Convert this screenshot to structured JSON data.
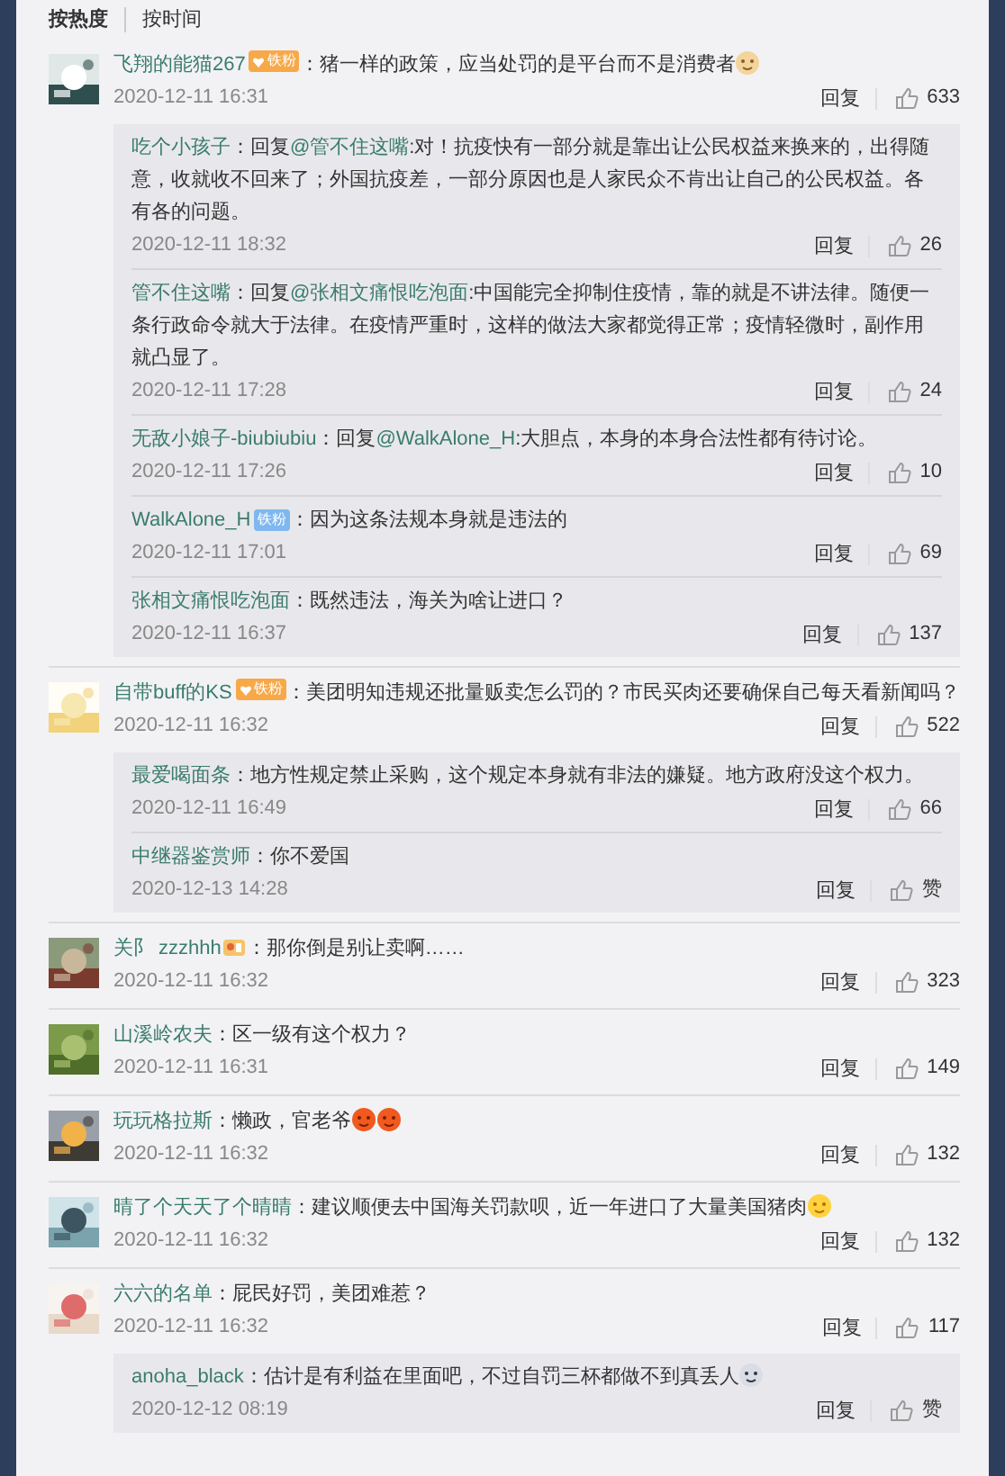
{
  "tabs": [
    {
      "label": "按热度",
      "selected": true
    },
    {
      "label": "按时间",
      "selected": false
    }
  ],
  "comments": [
    {
      "avatar": {
        "kind": "picture"
      },
      "user": "飞翔的能猫267",
      "badge": {
        "kind": "orange",
        "label": "铁粉"
      },
      "text": "：猪一样的政策，应当处罚的是平台而不是消费者",
      "emojis": [
        {
          "kind": "doge"
        }
      ],
      "date": "2020-12-11 16:31",
      "reply_label": "回复",
      "likes": "633",
      "replies": [
        {
          "user": "吃个小孩子",
          "prefix": "：回复",
          "mention": "@管不住这嘴",
          "text": ":对！抗疫快有一部分就是靠出让公民权益来换来的，出得随意，收就收不回来了；外国抗疫差，一部分原因也是人家民众不肯出让自己的公民权益。各有各的问题。",
          "date": "2020-12-11 18:32",
          "reply_label": "回复",
          "likes": "26"
        },
        {
          "user": "管不住这嘴",
          "prefix": "：回复",
          "mention": "@张相文痛恨吃泡面",
          "text": ":中国能完全抑制住疫情，靠的就是不讲法律。随便一条行政命令就大于法律。在疫情严重时，这样的做法大家都觉得正常；疫情轻微时，副作用就凸显了。",
          "date": "2020-12-11 17:28",
          "reply_label": "回复",
          "likes": "24"
        },
        {
          "user": "无敌小娘子-biubiubiu",
          "prefix": "：回复",
          "mention": "@WalkAlone_H",
          "text": ":大胆点，本身的本身合法性都有待讨论。",
          "date": "2020-12-11 17:26",
          "reply_label": "回复",
          "likes": "10"
        },
        {
          "user": "WalkAlone_H",
          "badge": {
            "kind": "blue",
            "label": "铁粉"
          },
          "text": "：因为这条法规本身就是违法的",
          "date": "2020-12-11 17:01",
          "reply_label": "回复",
          "likes": "69"
        },
        {
          "user": "张相文痛恨吃泡面",
          "text": "：既然违法，海关为啥让进口？",
          "date": "2020-12-11 16:37",
          "reply_label": "回复",
          "likes": "137"
        }
      ]
    },
    {
      "avatar": {
        "kind": "picture"
      },
      "user": "自带buff的KS",
      "badge": {
        "kind": "orange",
        "label": "铁粉"
      },
      "text": "：美团明知违规还批量贩卖怎么罚的？市民买肉还要确保自己每天看新闻吗？",
      "date": "2020-12-11 16:32",
      "reply_label": "回复",
      "likes": "522",
      "replies": [
        {
          "user": "最爱喝面条",
          "text": "：地方性规定禁止采购，这个规定本身就有非法的嫌疑。地方政府没这个权力。",
          "date": "2020-12-11 16:49",
          "reply_label": "回复",
          "likes": "66"
        },
        {
          "user": "中继器鉴赏师",
          "text": "：你不爱国",
          "date": "2020-12-13 14:28",
          "reply_label": "回复",
          "likes": "赞"
        }
      ]
    },
    {
      "avatar": {
        "kind": "picture"
      },
      "user": "关阝 zzzhhh",
      "badge": {
        "kind": "icon"
      },
      "text": "：那你倒是别让卖啊……",
      "date": "2020-12-11 16:32",
      "reply_label": "回复",
      "likes": "323"
    },
    {
      "avatar": {
        "kind": "picture"
      },
      "user": "山溪岭农夫",
      "text": "：区一级有这个权力？",
      "date": "2020-12-11 16:31",
      "reply_label": "回复",
      "likes": "149"
    },
    {
      "avatar": {
        "kind": "picture"
      },
      "user": "玩玩格拉斯",
      "text": "：懒政，官老爷",
      "emojis": [
        {
          "kind": "angry"
        },
        {
          "kind": "angry"
        }
      ],
      "date": "2020-12-11 16:32",
      "reply_label": "回复",
      "likes": "132"
    },
    {
      "avatar": {
        "kind": "picture"
      },
      "user": "晴了个天天了个晴晴",
      "text": "：建议顺便去中国海关罚款呗，近一年进口了大量美国猪肉",
      "emojis": [
        {
          "kind": "yum"
        }
      ],
      "date": "2020-12-11 16:32",
      "reply_label": "回复",
      "likes": "132"
    },
    {
      "avatar": {
        "kind": "picture"
      },
      "user": "六六的名单",
      "text": "：屁民好罚，美团难惹？",
      "date": "2020-12-11 16:32",
      "reply_label": "回复",
      "likes": "117",
      "replies": [
        {
          "user": "anoha_black",
          "text": "：估计是有利益在里面吧，不过自罚三杯都做不到真丢人",
          "emojis": [
            {
              "kind": "shock"
            }
          ],
          "date": "2020-12-12 08:19",
          "reply_label": "回复",
          "likes": "赞"
        }
      ]
    }
  ]
}
